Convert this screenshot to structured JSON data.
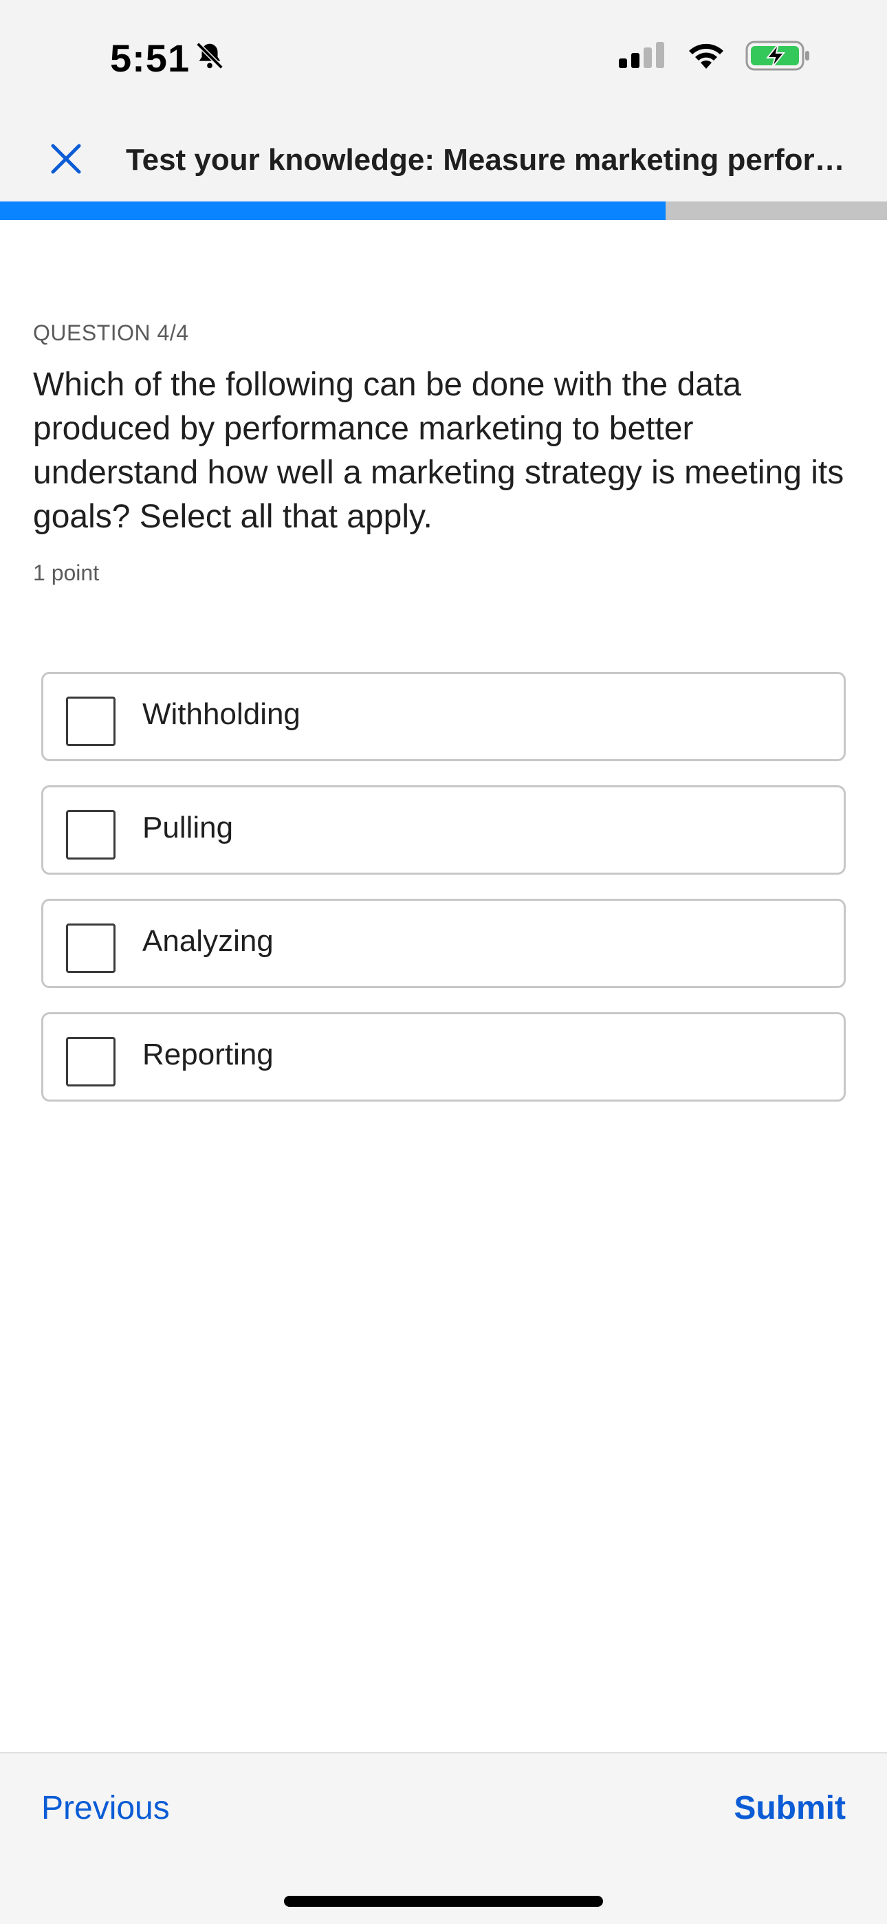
{
  "status_bar": {
    "time": "5:51",
    "icons": [
      "bell-slash-icon",
      "cellular-signal-icon",
      "wifi-icon",
      "battery-charging-icon"
    ],
    "battery_color": "#34c759"
  },
  "header": {
    "title": "Test your knowledge: Measure marketing performance",
    "close_icon": "close-icon"
  },
  "progress": {
    "fraction": 0.75,
    "fill_color": "#0a84ff"
  },
  "question": {
    "label": "QUESTION 4/4",
    "text": "Which of the following can be done with the data produced by performance marketing to better understand how well a marketing strategy is meeting its goals? Select all that apply.",
    "points": "1 point"
  },
  "options": [
    {
      "label": "Withholding",
      "checked": false
    },
    {
      "label": "Pulling",
      "checked": false
    },
    {
      "label": "Analyzing",
      "checked": false
    },
    {
      "label": "Reporting",
      "checked": false
    }
  ],
  "footer": {
    "previous_label": "Previous",
    "submit_label": "Submit",
    "accent_color": "#0b5cd5"
  }
}
